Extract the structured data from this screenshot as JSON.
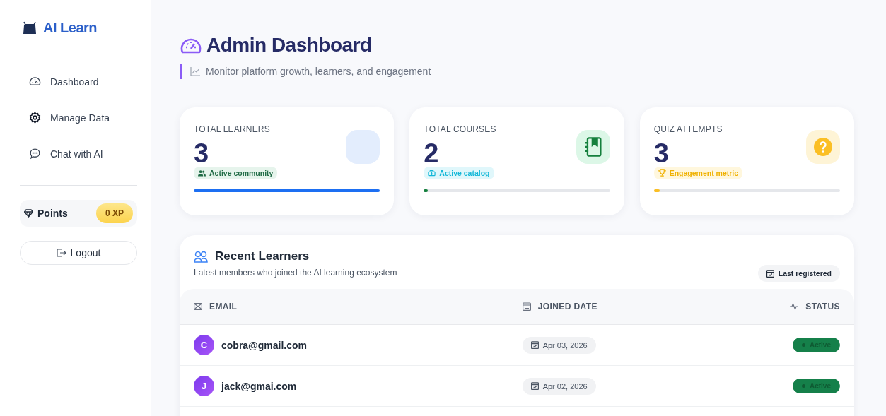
{
  "brand": {
    "name": "AI Learn"
  },
  "nav": [
    {
      "label": "Dashboard",
      "kind": "gauge"
    },
    {
      "label": "Manage Data",
      "kind": "gear"
    },
    {
      "label": "Chat with AI",
      "kind": "chat"
    }
  ],
  "points": {
    "label": "Points",
    "value": "0 XP"
  },
  "logout": {
    "label": "Logout"
  },
  "header": {
    "title": "Admin Dashboard",
    "subtitle": "Monitor platform growth, learners, and engagement"
  },
  "stats": [
    {
      "kind": "learners",
      "label": "TOTAL LEARNERS",
      "value": "3",
      "badge": "Active community",
      "level": 1.0
    },
    {
      "kind": "courses",
      "label": "TOTAL COURSES",
      "value": "2",
      "badge": "Active catalog",
      "level": 0.02
    },
    {
      "kind": "quiz",
      "label": "QUIZ ATTEMPTS",
      "value": "3",
      "badge": "Engagement metric",
      "level": 0.03
    }
  ],
  "recent": {
    "title": "Recent Learners",
    "subtitle": "Latest members who joined the AI learning ecosystem",
    "tag": "Last registered",
    "columns": [
      "EMAIL",
      "JOINED DATE",
      "STATUS"
    ],
    "rows": [
      {
        "initial": "C",
        "email": "cobra@gmail.com",
        "joined": "Apr 03, 2026",
        "status": "Active"
      },
      {
        "initial": "J",
        "email": "jack@gmai.com",
        "joined": "Apr 02, 2026",
        "status": "Active"
      }
    ]
  }
}
